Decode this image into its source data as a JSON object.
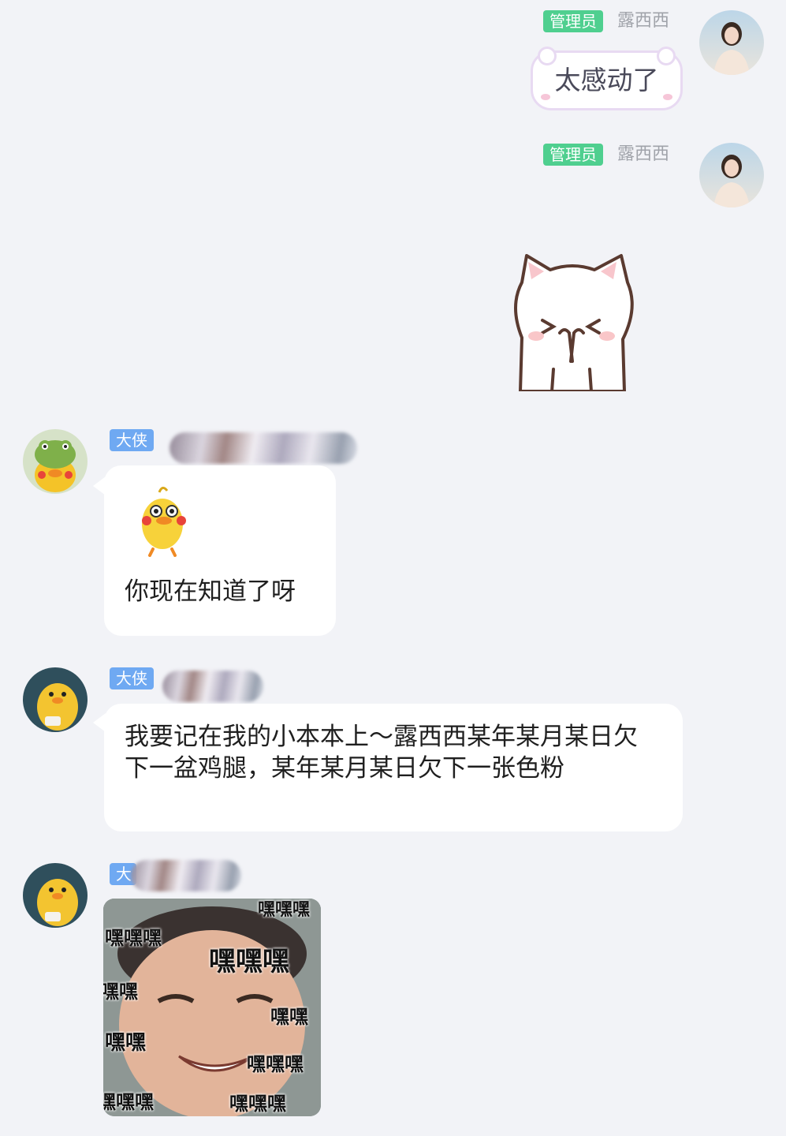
{
  "messages": [
    {
      "sender": "露西西",
      "role_badge": "管理员",
      "text": "太感动了"
    },
    {
      "sender": "露西西",
      "role_badge": "管理员",
      "sticker": "cat-covering-mouth-sticker"
    },
    {
      "role_badge": "大侠",
      "sticker": "yellow-duck-sticker",
      "text": "你现在知道了呀"
    },
    {
      "role_badge": "大侠",
      "text": "我要记在我的小本本上～露西西某年某月某日欠下一盆鸡腿，某年某月某日欠下一张色粉"
    },
    {
      "role_badge": "大侠",
      "image_text": [
        "嘿嘿嘿",
        "嘿嘿嘿",
        "嘿嘿嘿",
        "嘿嘿",
        "嘿嘿",
        "嘿嘿",
        "嘿嘿嘿",
        "嘿嘿嘿",
        "嘿嘿嘿"
      ]
    }
  ],
  "colors": {
    "admin_badge": "#4fcf8f",
    "member_badge": "#6fa9f2",
    "background": "#f2f3f7"
  }
}
